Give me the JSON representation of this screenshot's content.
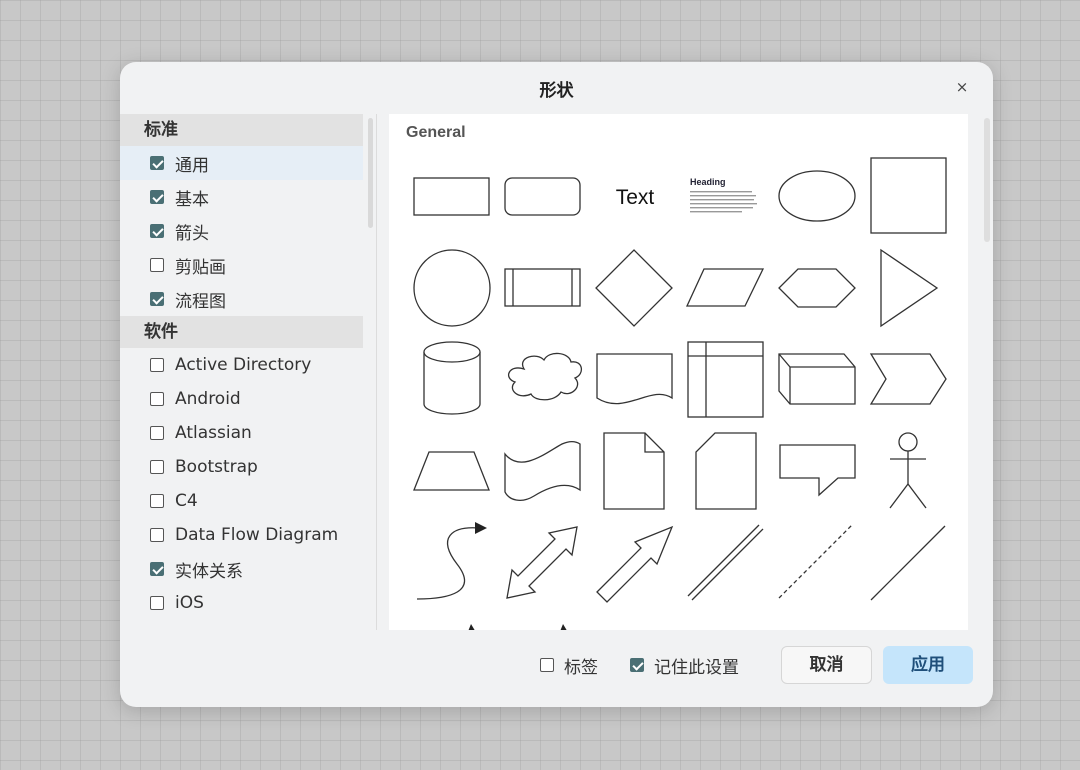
{
  "dialog": {
    "title": "形状",
    "close_symbol": "×"
  },
  "sidebar": {
    "sections": [
      {
        "header": "标准",
        "items": [
          {
            "label": "通用",
            "checked": true,
            "selected": true
          },
          {
            "label": "基本",
            "checked": true
          },
          {
            "label": "箭头",
            "checked": true
          },
          {
            "label": "剪贴画",
            "checked": false
          },
          {
            "label": "流程图",
            "checked": true
          }
        ]
      },
      {
        "header": "软件",
        "items": [
          {
            "label": "Active Directory",
            "checked": false
          },
          {
            "label": "Android",
            "checked": false
          },
          {
            "label": "Atlassian",
            "checked": false
          },
          {
            "label": "Bootstrap",
            "checked": false
          },
          {
            "label": "C4",
            "checked": false
          },
          {
            "label": "Data Flow Diagram",
            "checked": false
          },
          {
            "label": "实体关系",
            "checked": true
          },
          {
            "label": "iOS",
            "checked": false
          }
        ]
      }
    ]
  },
  "panel": {
    "title": "General",
    "preview_text": "Text",
    "preview_heading": "Heading",
    "shapes": [
      "rectangle",
      "rounded-rectangle",
      "text",
      "textbox",
      "ellipse",
      "square",
      "circle",
      "process",
      "diamond",
      "parallelogram",
      "hexagon",
      "triangle",
      "cylinder",
      "cloud",
      "document",
      "internal-storage",
      "cube",
      "step",
      "trapezoid",
      "tape",
      "note",
      "card",
      "callout",
      "actor",
      "curved-arrow",
      "bidirectional-arrow",
      "arrow",
      "double-line",
      "dashed-line",
      "line"
    ]
  },
  "footer": {
    "labels_checkbox": {
      "label": "标签",
      "checked": false
    },
    "remember_checkbox": {
      "label": "记住此设置",
      "checked": true
    },
    "cancel_label": "取消",
    "apply_label": "应用"
  },
  "colors": {
    "checkbox_checked": "#4a6f74",
    "apply_button": "#c5e5fb",
    "selected_item": "#e6eef6"
  }
}
